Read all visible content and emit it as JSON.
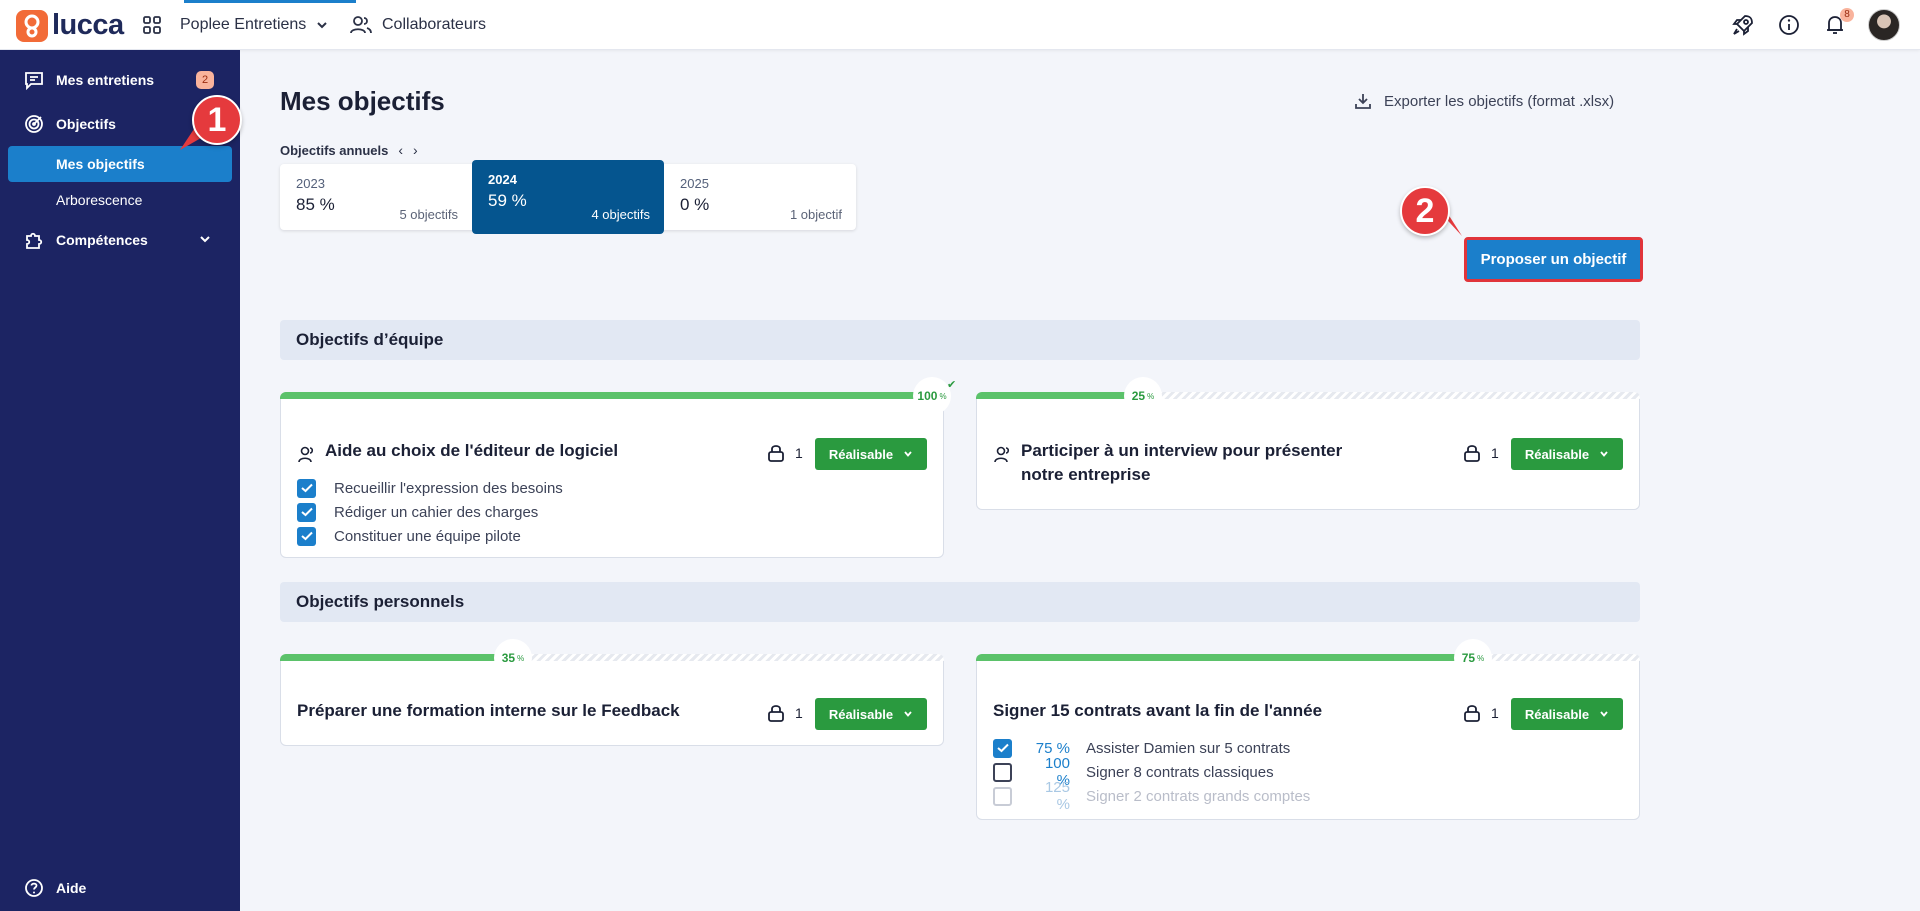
{
  "app": {
    "logo_text": "lucca",
    "module_name": "Poplee Entretiens",
    "collaborators_label": "Collaborateurs",
    "notifications_count": "8"
  },
  "sidebar": {
    "items": [
      {
        "label": "Mes entretiens",
        "badge": "2"
      },
      {
        "label": "Objectifs"
      },
      {
        "label": "Mes objectifs"
      },
      {
        "label": "Arborescence"
      },
      {
        "label": "Compétences"
      }
    ],
    "help_label": "Aide"
  },
  "markers": {
    "one": "1",
    "two": "2"
  },
  "page": {
    "title": "Mes objectifs",
    "export_label": "Exporter les objectifs (format .xlsx)",
    "annual_label": "Objectifs annuels",
    "propose_label": "Proposer un objectif"
  },
  "years": [
    {
      "year": "2023",
      "percent": "85 %",
      "count": "5 objectifs"
    },
    {
      "year": "2024",
      "percent": "59 %",
      "count": "4 objectifs"
    },
    {
      "year": "2025",
      "percent": "0 %",
      "count": "1 objectif"
    }
  ],
  "team_section": {
    "title": "Objectifs d’équipe",
    "cards": [
      {
        "title": "Aide au choix de l'éditeur de logiciel",
        "progress": 100,
        "pct_value": "100",
        "pct_unit": "%",
        "lock_count": "1",
        "status": "Réalisable",
        "subtasks": [
          {
            "label": "Recueillir l'expression des besoins",
            "checked": true
          },
          {
            "label": "Rédiger un cahier des charges",
            "checked": true
          },
          {
            "label": "Constituer une équipe pilote",
            "checked": true
          }
        ]
      },
      {
        "title_line1": "Participer à un interview pour présenter",
        "title_line2": "notre entreprise",
        "progress": 25,
        "pct_value": "25",
        "pct_unit": "%",
        "lock_count": "1",
        "status": "Réalisable"
      }
    ]
  },
  "personal_section": {
    "title": "Objectifs personnels",
    "cards": [
      {
        "title": "Préparer une formation interne sur le Feedback",
        "progress": 35,
        "pct_value": "35",
        "pct_unit": "%",
        "lock_count": "1",
        "status": "Réalisable"
      },
      {
        "title": "Signer 15 contrats avant la fin de l'année",
        "progress": 75,
        "pct_value": "75",
        "pct_unit": "%",
        "lock_count": "1",
        "status": "Réalisable",
        "subtasks": [
          {
            "pct": "75 %",
            "label": "Assister Damien sur 5 contrats",
            "checked": true
          },
          {
            "pct": "100 %",
            "label": "Signer 8 contrats classiques",
            "checked": false
          },
          {
            "pct": "125 %",
            "label": "Signer 2 contrats grands comptes",
            "checked": false
          }
        ]
      }
    ]
  }
}
